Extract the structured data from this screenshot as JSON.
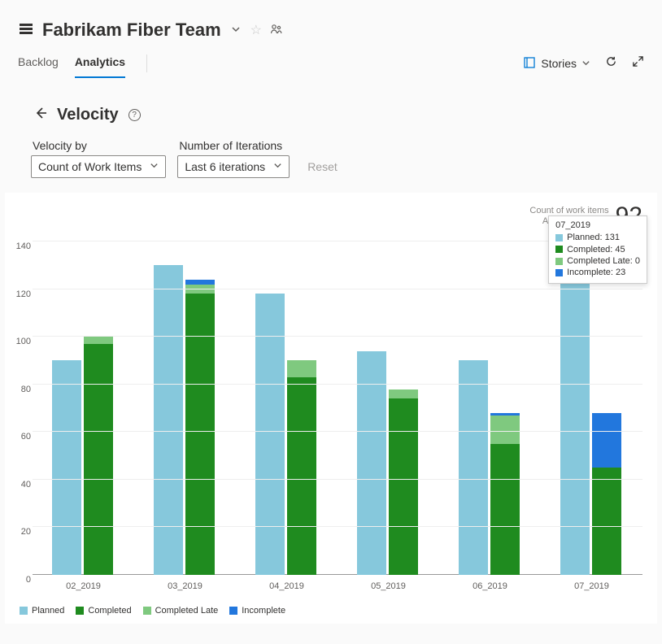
{
  "header": {
    "team_name": "Fabrikam Fiber Team"
  },
  "tabs": {
    "backlog": "Backlog",
    "analytics": "Analytics",
    "active": "analytics"
  },
  "right_controls": {
    "stories_label": "Stories"
  },
  "velocity": {
    "title": "Velocity"
  },
  "controls": {
    "velocity_by_label": "Velocity by",
    "velocity_by_value": "Count of Work Items",
    "iterations_label": "Number of Iterations",
    "iterations_value": "Last 6 iterations",
    "reset": "Reset"
  },
  "stats": {
    "line1": "Count of work items",
    "line2": "Average Velocity",
    "value": "92"
  },
  "legend": {
    "planned": "Planned",
    "completed": "Completed",
    "completed_late": "Completed Late",
    "incomplete": "Incomplete"
  },
  "tooltip": {
    "title": "07_2019",
    "planned": "Planned: 131",
    "completed": "Completed: 45",
    "completed_late": "Completed Late: 0",
    "incomplete": "Incomplete: 23"
  },
  "chart_data": {
    "type": "bar",
    "title": "Velocity",
    "ylabel": "Count of work items",
    "ylim": [
      0,
      140
    ],
    "yticks": [
      0,
      20,
      40,
      60,
      80,
      100,
      120,
      140
    ],
    "categories": [
      "02_2019",
      "03_2019",
      "04_2019",
      "05_2019",
      "06_2019",
      "07_2019"
    ],
    "series": [
      {
        "name": "Planned",
        "color": "#86c8dc",
        "values": [
          90,
          130,
          118,
          94,
          90,
          131
        ]
      },
      {
        "name": "Completed",
        "color": "#1f8b1f",
        "values": [
          97,
          118,
          83,
          74,
          55,
          45
        ]
      },
      {
        "name": "Completed Late",
        "color": "#7fc97f",
        "values": [
          3,
          4,
          7,
          4,
          12,
          0
        ]
      },
      {
        "name": "Incomplete",
        "color": "#2277dd",
        "values": [
          0,
          2,
          0,
          0,
          1,
          23
        ]
      }
    ]
  }
}
